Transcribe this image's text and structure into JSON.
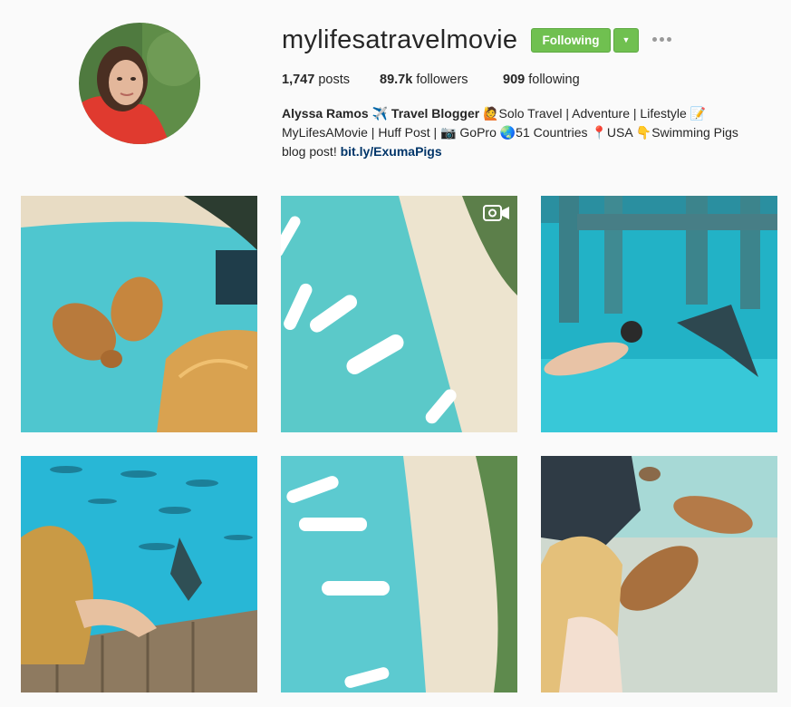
{
  "profile": {
    "username": "mylifesatravelmovie",
    "follow_label": "Following",
    "dropdown_glyph": "▼",
    "stats": {
      "posts_count": "1,747",
      "posts_label": " posts",
      "followers_count": "89.7k",
      "followers_label": " followers",
      "following_count": "909",
      "following_label": " following"
    },
    "bio": {
      "name": "Alyssa Ramos ✈️ Travel Blogger",
      "line1_rest": " 🙋Solo Travel | Adventure | Lifestyle 📝",
      "line2": "MyLifesAMovie | Huff Post | 📷 GoPro 🌏51 Countries 📍USA 👇Swimming Pigs",
      "line3_prefix": "blog post! ",
      "link": "bit.ly/ExumaPigs"
    }
  },
  "colors": {
    "follow_green": "#70c050",
    "link_blue": "#003569",
    "water": "#37c5d8",
    "sand": "#efe7d6"
  },
  "icons": {
    "more": "ellipsis-icon",
    "video": "video-camera-icon"
  }
}
